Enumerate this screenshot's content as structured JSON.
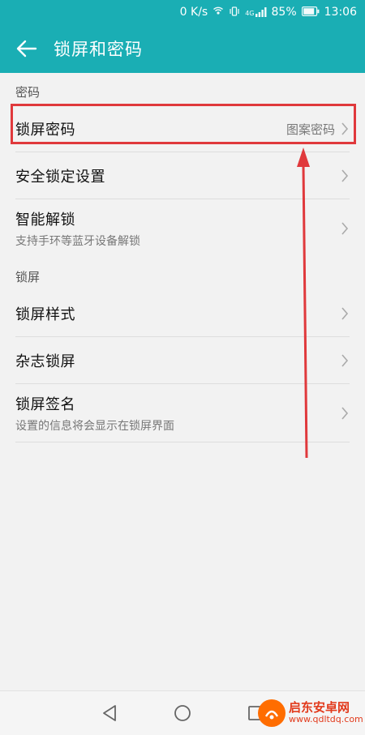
{
  "status_bar": {
    "speed": "0 K/s",
    "signal_label": "4G",
    "battery": "85%",
    "time": "13:06"
  },
  "app_bar": {
    "title": "锁屏和密码",
    "back_icon": "arrow-left-icon"
  },
  "sections": [
    {
      "header": "密码",
      "items": [
        {
          "label": "锁屏密码",
          "value": "图案密码",
          "highlighted": true
        },
        {
          "label": "安全锁定设置"
        },
        {
          "label": "智能解锁",
          "subtitle": "支持手环等蓝牙设备解锁"
        }
      ]
    },
    {
      "header": "锁屏",
      "items": [
        {
          "label": "锁屏样式"
        },
        {
          "label": "杂志锁屏"
        },
        {
          "label": "锁屏签名",
          "subtitle": "设置的信息将会显示在锁屏界面"
        }
      ]
    }
  ],
  "annotation": {
    "color": "#e0393c"
  },
  "nav_bar": {
    "icons": [
      "back-triangle-icon",
      "home-circle-icon",
      "recents-square-icon"
    ]
  },
  "watermark": {
    "title": "启东安卓网",
    "url": "www.qdltdq.com"
  },
  "colors": {
    "accent": "#1aaeb4",
    "highlight": "#e0393c"
  }
}
